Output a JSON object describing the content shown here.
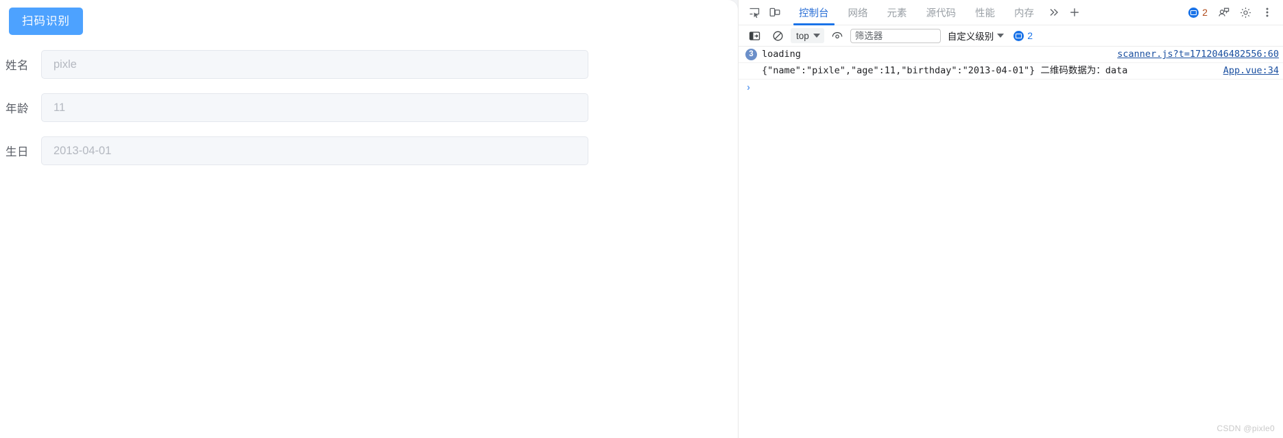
{
  "page": {
    "scan_button_label": "扫码识别",
    "fields": [
      {
        "label": "姓名",
        "value": "pixle",
        "placeholder": "pixle"
      },
      {
        "label": "年龄",
        "value": "11",
        "placeholder": "11"
      },
      {
        "label": "生日",
        "value": "2013-04-01",
        "placeholder": "2013-04-01"
      }
    ]
  },
  "devtools": {
    "tabs": [
      {
        "label": "控制台",
        "active": true
      },
      {
        "label": "网络",
        "active": false
      },
      {
        "label": "元素",
        "active": false
      },
      {
        "label": "源代码",
        "active": false
      },
      {
        "label": "性能",
        "active": false
      },
      {
        "label": "内存",
        "active": false
      }
    ],
    "more_tabs_icon": "chevron-double-right-icon",
    "add_tab_icon": "plus-icon",
    "inspect_icon": "inspect-element-icon",
    "device_icon": "device-toolbar-icon",
    "issues_count": "2",
    "settings_icon": "gear-icon",
    "more_options_icon": "kebab-menu-icon",
    "account_icon": "profile-icon",
    "console_toolbar": {
      "sidebar_icon": "console-sidebar-icon",
      "clear_icon": "clear-console-icon",
      "context": "top",
      "eye_icon": "live-expression-icon",
      "filter_placeholder": "筛选器",
      "filter_value": "",
      "level": "自定义级别",
      "message_count": "2"
    },
    "logs": [
      {
        "count": "3",
        "text": "loading",
        "source": "scanner.js?t=1712046482556:60",
        "indented": false
      },
      {
        "count": "",
        "text": "{\"name\":\"pixle\",\"age\":11,\"birthday\":\"2013-04-01\"} 二维码数据为：data",
        "source": "App.vue:34",
        "indented": true
      }
    ],
    "prompt_symbol": "›"
  },
  "watermark": "CSDN @pixle0",
  "colors": {
    "primary_button": "#4da2ff",
    "tab_active": "#1a73e8",
    "link": "#1a4fa0",
    "input_bg": "#f5f7fa"
  }
}
